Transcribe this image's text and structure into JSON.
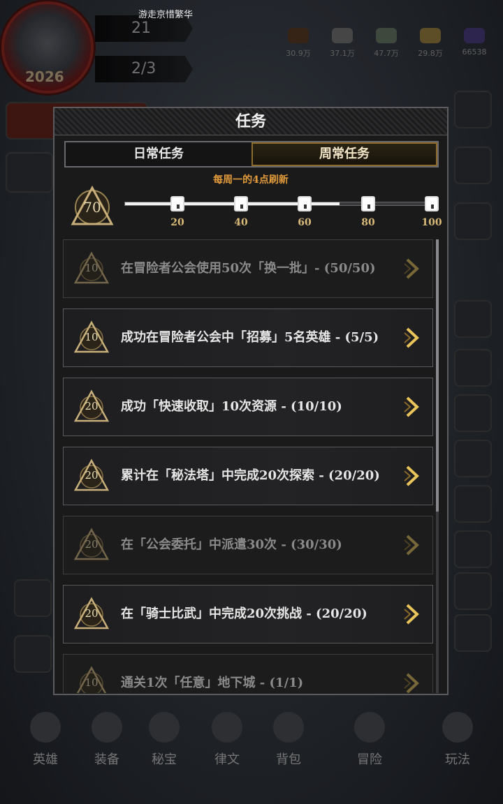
{
  "hud": {
    "player_name": "游走京惜繁华",
    "avatar_year": "2026",
    "stat_1": "21",
    "stat_2": "2/3",
    "resources": [
      {
        "icon": "wood-icon",
        "value": "30.9万"
      },
      {
        "icon": "stone-icon",
        "value": "37.1万"
      },
      {
        "icon": "ore-icon",
        "value": "47.7万"
      },
      {
        "icon": "grain-icon",
        "value": "29.8万"
      },
      {
        "icon": "crystal-icon",
        "value": "66538"
      }
    ]
  },
  "bottom_nav": [
    {
      "label": "英雄",
      "icon": "hero-icon"
    },
    {
      "label": "装备",
      "icon": "equipment-icon"
    },
    {
      "label": "秘宝",
      "icon": "treasure-icon"
    },
    {
      "label": "律文",
      "icon": "rune-icon"
    },
    {
      "label": "背包",
      "icon": "bag-icon"
    },
    {
      "label": "冒险",
      "icon": "adventure-icon"
    },
    {
      "label": "玩法",
      "icon": "gameplay-icon"
    }
  ],
  "modal": {
    "title": "任务",
    "tabs": [
      {
        "label": "日常任务",
        "active": false
      },
      {
        "label": "周常任务",
        "active": true
      }
    ],
    "refresh_note": "每周一的4点刷新",
    "points": "70",
    "progress": {
      "value": 70,
      "max": 100
    },
    "milestones": [
      "20",
      "40",
      "60",
      "80",
      "100"
    ],
    "tasks": [
      {
        "points": "10",
        "text": "在冒险者公会使用50次「换一批」- (50/50)",
        "done": true
      },
      {
        "points": "10",
        "text": "成功在冒险者公会中「招募」5名英雄 - (5/5)",
        "done": false
      },
      {
        "points": "20",
        "text": "成功「快速收取」10次资源 - (10/10)",
        "done": false
      },
      {
        "points": "20",
        "text": "累计在「秘法塔」中完成20次探索 - (20/20)",
        "done": false
      },
      {
        "points": "20",
        "text": "在「公会委托」中派遣30次 - (30/30)",
        "done": true
      },
      {
        "points": "20",
        "text": "在「骑士比武」中完成20次挑战 - (20/20)",
        "done": false
      },
      {
        "points": "10",
        "text": "通关1次「任意」地下城 - (1/1)",
        "done": true
      }
    ]
  },
  "colors": {
    "accent_gold": "#d8b978",
    "refresh_orange": "#e09a3b",
    "panel_bg": "#1a1a1b"
  }
}
